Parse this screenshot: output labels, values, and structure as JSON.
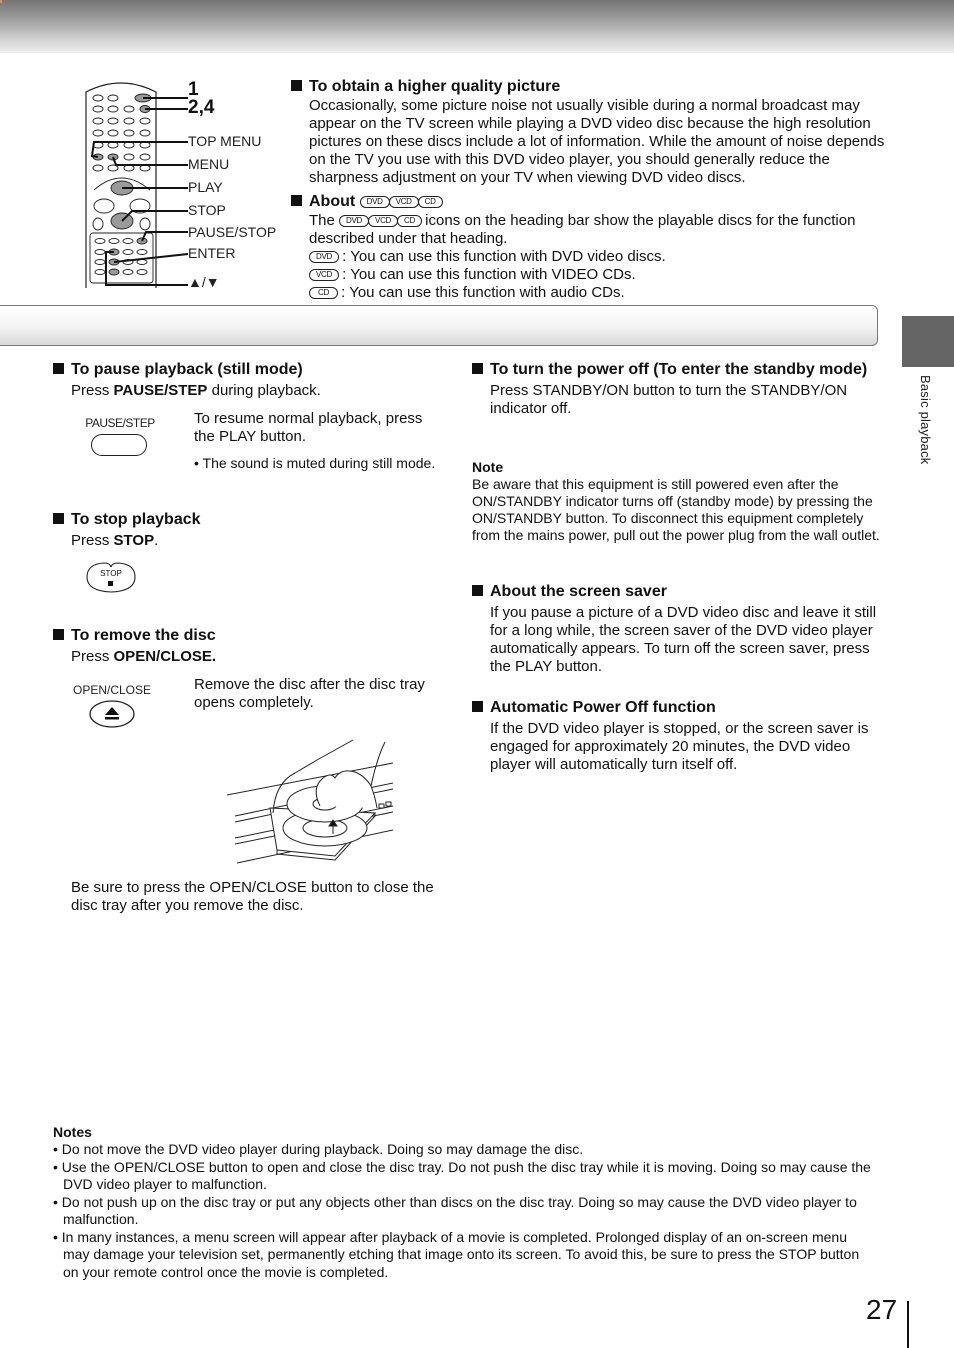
{
  "remote": {
    "callouts": [
      "1",
      "2,4"
    ],
    "labels": [
      "TOP MENU",
      "MENU",
      "PLAY",
      "STOP",
      "PAUSE/STOP",
      "ENTER",
      "▲/▼"
    ]
  },
  "intro": {
    "quality": {
      "heading": "To obtain a higher quality picture",
      "body": "Occasionally, some picture noise not usually visible during a normal broadcast may appear on the TV screen while playing a DVD video disc because the high resolution pictures on these discs include a lot of information. While the amount of noise depends on the TV you use with this DVD video player, you should generally reduce the sharpness adjustment on your TV when viewing DVD video discs."
    },
    "about": {
      "heading": "About",
      "badges": [
        "DVD",
        "VCD",
        "CD"
      ],
      "line_prefix": "The",
      "line_suffix": "icons on the heading bar show the playable discs for the function described under that heading.",
      "items": [
        {
          "badge": "DVD",
          "text": ": You can use this function with DVD video discs."
        },
        {
          "badge": "VCD",
          "text": ": You can use this function with VIDEO CDs."
        },
        {
          "badge": "CD",
          "text": ": You can use this function with audio CDs."
        }
      ]
    }
  },
  "side_tab": {
    "label": "Basic playback",
    "color": "#656565"
  },
  "left": {
    "pause": {
      "heading": "To pause playback (still mode)",
      "press_prefix": "Press ",
      "press_key": "PAUSE/STEP",
      "press_suffix": " during playback.",
      "button_label": "PAUSE/STEP",
      "resume": "To resume normal playback, press the PLAY button.",
      "bullet": "• The sound is muted during still mode."
    },
    "stop": {
      "heading": "To stop playback",
      "press_prefix": "Press ",
      "press_key": "STOP",
      "press_suffix": ".",
      "button_label": "STOP"
    },
    "remove": {
      "heading": "To remove the disc",
      "press_prefix": "Press ",
      "press_key": "OPEN/CLOSE.",
      "button_label": "OPEN/CLOSE",
      "instruction": "Remove the disc after the disc tray opens completely.",
      "closing": "Be sure to press the OPEN/CLOSE button to close the disc tray after you remove the disc."
    }
  },
  "right": {
    "power": {
      "heading": "To turn the power off (To enter the standby mode)",
      "body": "Press STANDBY/ON button to turn the STANDBY/ON indicator off."
    },
    "note": {
      "title": "Note",
      "body": "Be aware that this equipment is still powered even after the ON/STANDBY indicator turns off (standby mode) by pressing the ON/STANDBY button. To disconnect this equipment completely from the mains power, pull out the power plug from the wall outlet."
    },
    "screensaver": {
      "heading": "About the screen saver",
      "body": "If you pause a picture of a DVD video disc and leave it still for a long while, the screen saver of the DVD video player automatically appears. To turn off the screen saver, press the PLAY button."
    },
    "autopower": {
      "heading": "Automatic Power Off function",
      "body": "If the DVD video player is stopped, or the screen saver is engaged for approximately 20 minutes, the DVD video player will automatically turn itself off."
    }
  },
  "notes": {
    "title": "Notes",
    "items": [
      "• Do not move the DVD video player during playback. Doing so may damage the disc.",
      "• Use the OPEN/CLOSE button to open and close the disc tray. Do not push the disc tray while it is moving. Doing so may cause the DVD video player to malfunction.",
      "• Do not push up on the disc tray or put any objects other than discs on the disc tray. Doing so may cause the DVD video player to malfunction.",
      "• In many instances, a menu screen will appear after playback of a movie is completed.  Prolonged display of an on-screen menu may damage your television set, permanently etching that image onto its screen. To avoid this, be sure to press the STOP button on your remote control once the movie is completed."
    ]
  },
  "page_number": "27"
}
